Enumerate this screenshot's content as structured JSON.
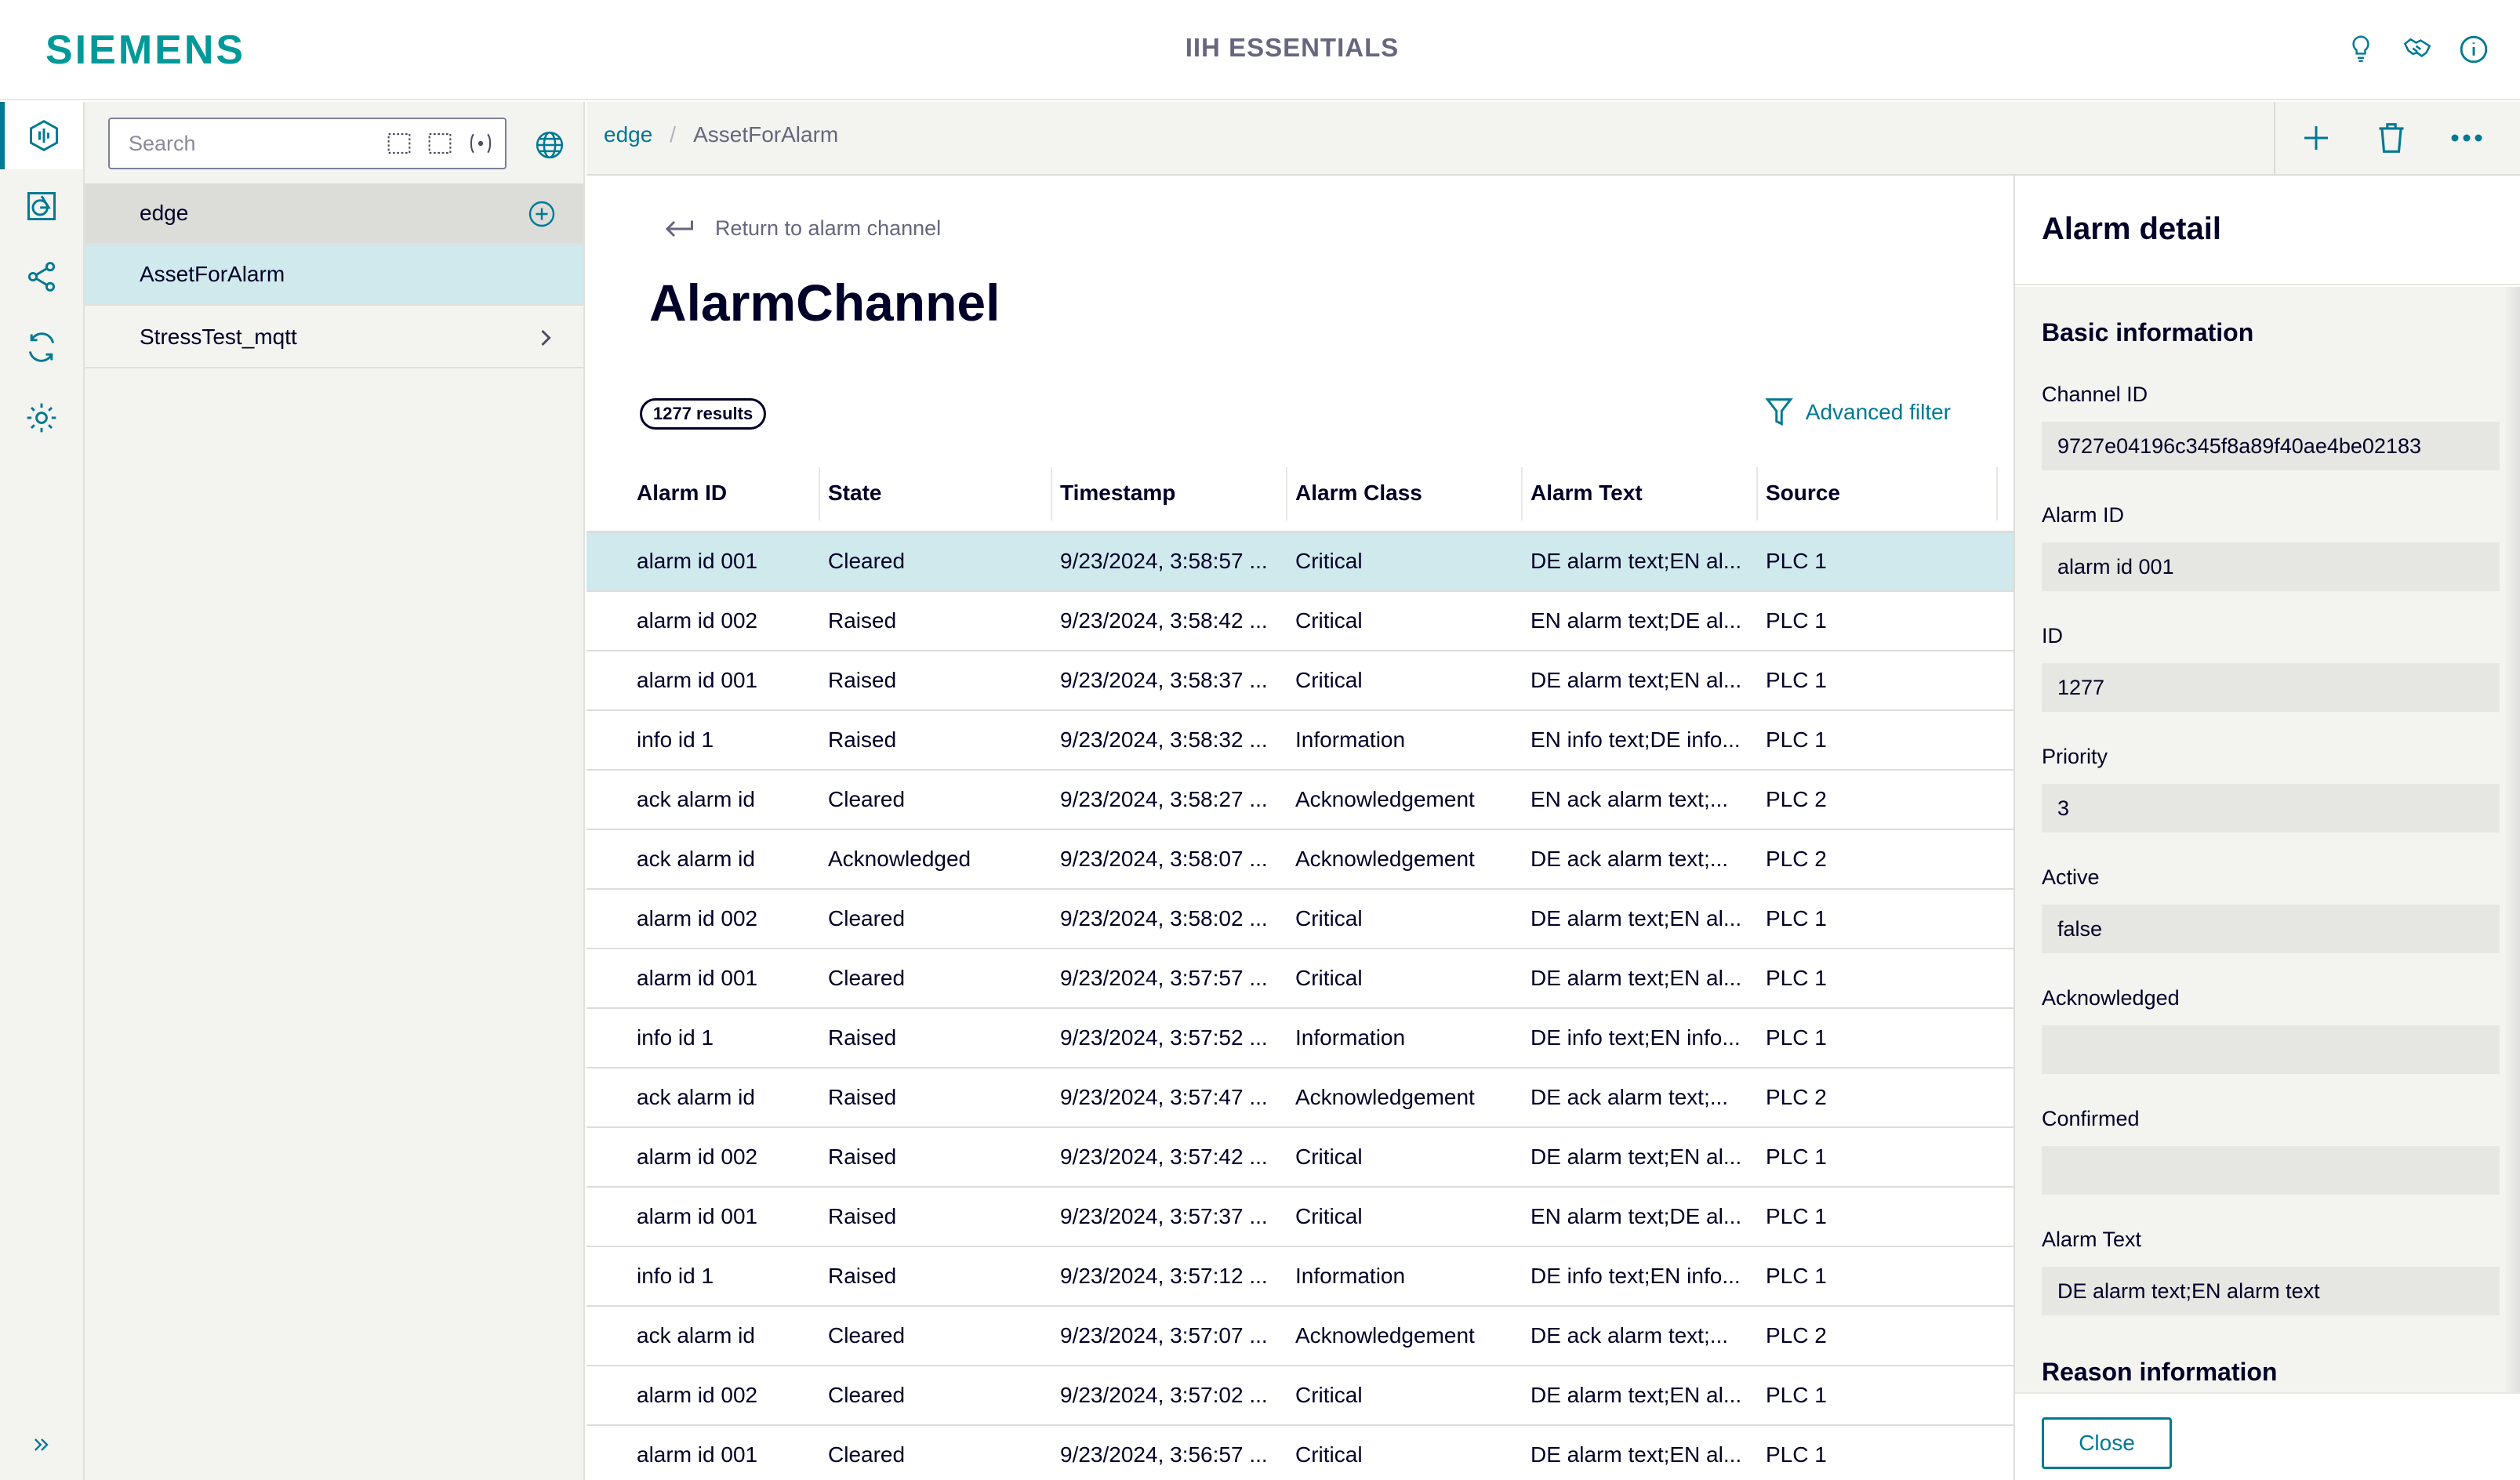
{
  "header": {
    "logo": "SIEMENS",
    "title": "IIH ESSENTIALS",
    "icons": [
      "lightbulb-icon",
      "handshake-icon",
      "info-icon"
    ]
  },
  "nav": {
    "items": [
      "dashboard-icon",
      "shapes-icon",
      "share-icon",
      "sync-icon",
      "settings-icon"
    ],
    "expand": "double-chevron-right-icon"
  },
  "tree": {
    "search_placeholder": "Search",
    "nodes": [
      {
        "label": "edge"
      },
      {
        "label": "AssetForAlarm"
      },
      {
        "label": "StressTest_mqtt"
      }
    ]
  },
  "breadcrumb": {
    "items": [
      "edge",
      "AssetForAlarm"
    ],
    "sep": "/"
  },
  "main": {
    "return_label": "Return to alarm channel",
    "title": "AlarmChannel",
    "results": "1277 results",
    "advanced_filter": "Advanced filter",
    "columns": [
      "Alarm ID",
      "State",
      "Timestamp",
      "Alarm Class",
      "Alarm Text",
      "Source"
    ],
    "rows": [
      [
        "alarm id 001",
        "Cleared",
        "9/23/2024, 3:58:57 ...",
        "Critical",
        "DE alarm text;EN al...",
        "PLC 1"
      ],
      [
        "alarm id 002",
        "Raised",
        "9/23/2024, 3:58:42 ...",
        "Critical",
        "EN alarm text;DE al...",
        "PLC 1"
      ],
      [
        "alarm id 001",
        "Raised",
        "9/23/2024, 3:58:37 ...",
        "Critical",
        "DE alarm text;EN al...",
        "PLC 1"
      ],
      [
        "info id 1",
        "Raised",
        "9/23/2024, 3:58:32 ...",
        "Information",
        "EN info text;DE info...",
        "PLC 1"
      ],
      [
        "ack alarm id",
        "Cleared",
        "9/23/2024, 3:58:27 ...",
        "Acknowledgement",
        "EN ack alarm text;...",
        "PLC 2"
      ],
      [
        "ack alarm id",
        "Acknowledged",
        "9/23/2024, 3:58:07 ...",
        "Acknowledgement",
        "DE ack alarm text;...",
        "PLC 2"
      ],
      [
        "alarm id 002",
        "Cleared",
        "9/23/2024, 3:58:02 ...",
        "Critical",
        "DE alarm text;EN al...",
        "PLC 1"
      ],
      [
        "alarm id 001",
        "Cleared",
        "9/23/2024, 3:57:57 ...",
        "Critical",
        "DE alarm text;EN al...",
        "PLC 1"
      ],
      [
        "info id 1",
        "Raised",
        "9/23/2024, 3:57:52 ...",
        "Information",
        "DE info text;EN info...",
        "PLC 1"
      ],
      [
        "ack alarm id",
        "Raised",
        "9/23/2024, 3:57:47 ...",
        "Acknowledgement",
        "DE ack alarm text;...",
        "PLC 2"
      ],
      [
        "alarm id 002",
        "Raised",
        "9/23/2024, 3:57:42 ...",
        "Critical",
        "DE alarm text;EN al...",
        "PLC 1"
      ],
      [
        "alarm id 001",
        "Raised",
        "9/23/2024, 3:57:37 ...",
        "Critical",
        "EN alarm text;DE al...",
        "PLC 1"
      ],
      [
        "info id 1",
        "Raised",
        "9/23/2024, 3:57:12 ...",
        "Information",
        "DE info text;EN info...",
        "PLC 1"
      ],
      [
        "ack alarm id",
        "Cleared",
        "9/23/2024, 3:57:07 ...",
        "Acknowledgement",
        "DE ack alarm text;...",
        "PLC 2"
      ],
      [
        "alarm id 002",
        "Cleared",
        "9/23/2024, 3:57:02 ...",
        "Critical",
        "DE alarm text;EN al...",
        "PLC 1"
      ],
      [
        "alarm id 001",
        "Cleared",
        "9/23/2024, 3:56:57 ...",
        "Critical",
        "DE alarm text;EN al...",
        "PLC 1"
      ]
    ]
  },
  "detail": {
    "title": "Alarm detail",
    "basic_title": "Basic information",
    "fields": [
      {
        "label": "Channel ID",
        "value": "9727e04196c345f8a89f40ae4be02183"
      },
      {
        "label": "Alarm ID",
        "value": "alarm id 001"
      },
      {
        "label": "ID",
        "value": "1277"
      },
      {
        "label": "Priority",
        "value": "3"
      },
      {
        "label": "Active",
        "value": "false"
      },
      {
        "label": "Acknowledged",
        "value": ""
      },
      {
        "label": "Confirmed",
        "value": ""
      },
      {
        "label": "Alarm Text",
        "value": "DE alarm text;EN alarm text"
      }
    ],
    "reason_title": "Reason information",
    "close_label": "Close"
  },
  "colors": {
    "accent": "#007993",
    "brand": "#009999",
    "selected_row": "#cfe9ed",
    "panel_bg": "#f3f3f0"
  }
}
